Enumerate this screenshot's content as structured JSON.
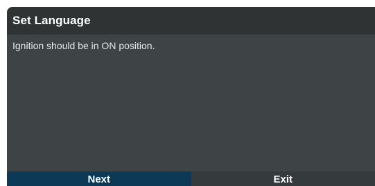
{
  "dialog": {
    "title": "Set Language",
    "message": "Ignition should be in ON position.",
    "buttons": {
      "next_label": "Next",
      "exit_label": "Exit"
    }
  },
  "colors": {
    "title_bar": "#2f3334",
    "body": "#3e4446",
    "next_button": "#0c3a56",
    "exit_button": "#353a3c"
  }
}
